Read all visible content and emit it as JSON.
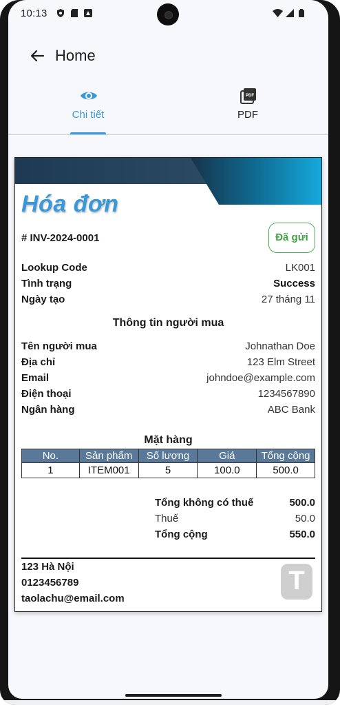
{
  "status_bar": {
    "time": "10:13"
  },
  "app_bar": {
    "title": "Home"
  },
  "tabs": [
    {
      "label": "Chi tiết",
      "icon": "eye-icon",
      "active": true
    },
    {
      "label": "PDF",
      "icon": "pdf-icon",
      "active": false
    }
  ],
  "colors": {
    "accent": "#3a97d8",
    "status_green": "#43a047",
    "table_header": "#5a7898"
  },
  "invoice": {
    "title": "Hóa đơn",
    "number": "# INV-2024-0001",
    "status_chip": "Đã gửi",
    "info": {
      "lookup_code_label": "Lookup Code",
      "lookup_code_value": "LK001",
      "status_label": "Tình trạng",
      "status_value": "Success",
      "created_label": "Ngày tạo",
      "created_value": "27 tháng 11"
    },
    "buyer_section_title": "Thông tin người mua",
    "buyer": {
      "name_label": "Tên người mua",
      "name_value": "Johnathan Doe",
      "address_label": "Địa chỉ",
      "address_value": "123 Elm Street",
      "email_label": "Email",
      "email_value": "johndoe@example.com",
      "phone_label": "Điện thoại",
      "phone_value": "1234567890",
      "bank_label": "Ngân hàng",
      "bank_value": "ABC Bank"
    },
    "items_section_title": "Mặt hàng",
    "items_table": {
      "headers": [
        "No.",
        "Sản phẩm",
        "Số lượng",
        "Giá",
        "Tổng cộng"
      ],
      "rows": [
        [
          "1",
          "ITEM001",
          "5",
          "100.0",
          "500.0"
        ]
      ]
    },
    "totals": {
      "subtotal_label": "Tổng không có thuế",
      "subtotal_value": "500.0",
      "tax_label": "Thuế",
      "tax_value": "50.0",
      "total_label": "Tổng cộng",
      "total_value": "550.0"
    },
    "footer": {
      "address": "123 Hà Nội",
      "phone": "0123456789",
      "email": "taolachu@email.com",
      "logo_letter": "T"
    }
  }
}
